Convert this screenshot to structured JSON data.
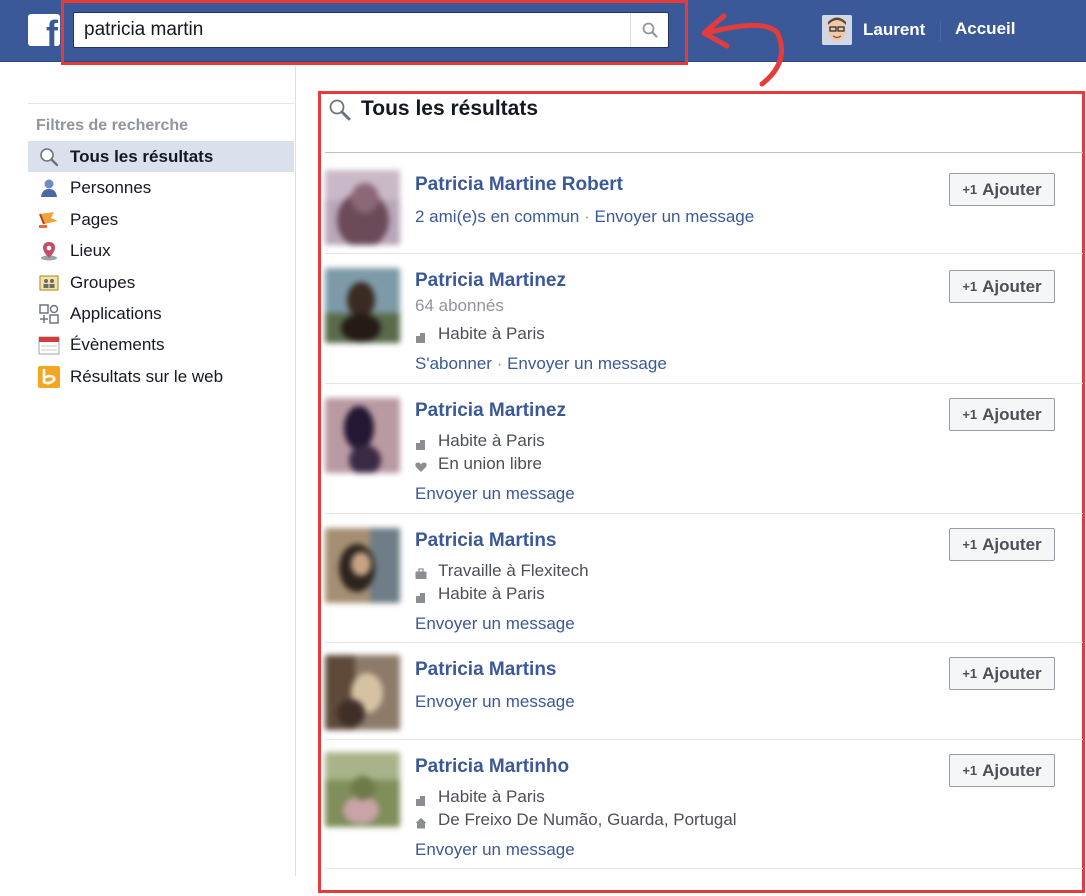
{
  "topbar": {
    "logo_letter": "f",
    "search_value": "patricia martin",
    "search_icon": "search-icon",
    "user_name": "Laurent",
    "home_label": "Accueil",
    "accent_color": "#3b5998",
    "highlight_color": "#e53b3b"
  },
  "sidebar": {
    "heading": "Filtres de recherche",
    "items": [
      {
        "label": "Tous les résultats",
        "icon": "search-icon",
        "active": true
      },
      {
        "label": "Personnes",
        "icon": "person-icon"
      },
      {
        "label": "Pages",
        "icon": "flag-icon"
      },
      {
        "label": "Lieux",
        "icon": "map-pin-icon"
      },
      {
        "label": "Groupes",
        "icon": "group-icon"
      },
      {
        "label": "Applications",
        "icon": "apps-icon"
      },
      {
        "label": "Évènements",
        "icon": "calendar-icon"
      },
      {
        "label": "Résultats sur le web",
        "icon": "bing-icon"
      }
    ]
  },
  "results": {
    "title": "Tous les résultats",
    "add_label": "Ajouter",
    "add_plus": "+1",
    "items": [
      {
        "name": "Patricia Martine Robert",
        "mutual": "2 ami(e)s en commun",
        "separator": " · ",
        "message": "Envoyer un message"
      },
      {
        "name": "Patricia Martinez",
        "followers": "64 abonnés",
        "lives": "Habite à Paris",
        "subscribe": "S'abonner",
        "separator": " · ",
        "message": "Envoyer un message"
      },
      {
        "name": "Patricia Martinez",
        "lives": "Habite à Paris",
        "relationship": "En union libre",
        "message": "Envoyer un message"
      },
      {
        "name": "Patricia Martins",
        "work": "Travaille à Flexitech",
        "lives": "Habite à Paris",
        "message": "Envoyer un message"
      },
      {
        "name": "Patricia Martins",
        "message": "Envoyer un message"
      },
      {
        "name": "Patricia Martinho",
        "lives": "Habite à Paris",
        "from": "De Freixo De Numão, Guarda, Portugal",
        "message": "Envoyer un message"
      }
    ]
  }
}
